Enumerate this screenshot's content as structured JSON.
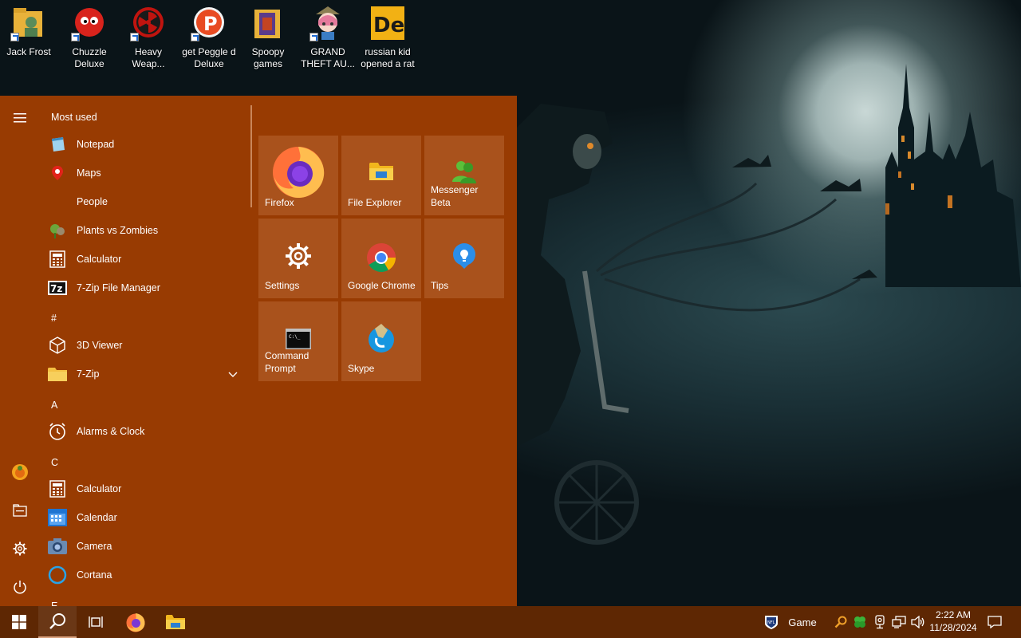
{
  "desktop": {
    "icons": [
      {
        "label": "Jack Frost",
        "icon": "folder-person-icon"
      },
      {
        "label": "Chuzzle\nDeluxe",
        "icon": "chuzzle-icon"
      },
      {
        "label": "Heavy\nWeap...",
        "icon": "radiation-icon"
      },
      {
        "label": "get Peggle d\nDeluxe",
        "icon": "peggle-icon"
      },
      {
        "label": "Spoopy\ngames",
        "icon": "folder-icon"
      },
      {
        "label": "GRAND\nTHEFT AU...",
        "icon": "anime-girl-icon"
      },
      {
        "label": "russian kid\nopened a rat",
        "icon": "de-icon"
      }
    ]
  },
  "start_menu": {
    "most_used_label": "Most used",
    "most_used": [
      {
        "label": "Notepad",
        "icon": "notepad-icon"
      },
      {
        "label": "Maps",
        "icon": "maps-icon"
      },
      {
        "label": "People",
        "icon": "people-icon"
      },
      {
        "label": "Plants vs Zombies",
        "icon": "plants-vs-zombies-icon"
      },
      {
        "label": "Calculator",
        "icon": "calculator-icon"
      },
      {
        "label": "7-Zip File Manager",
        "icon": "7zip-icon"
      }
    ],
    "sections": {
      "hash": "#",
      "a": "A",
      "c": "C",
      "e": "E"
    },
    "apps_hash": [
      {
        "label": "3D Viewer",
        "icon": "cube-icon"
      },
      {
        "label": "7-Zip",
        "icon": "folder-icon"
      }
    ],
    "apps_a": [
      {
        "label": "Alarms & Clock",
        "icon": "alarm-clock-icon"
      }
    ],
    "apps_c": [
      {
        "label": "Calculator",
        "icon": "calculator-icon"
      },
      {
        "label": "Calendar",
        "icon": "calendar-icon"
      },
      {
        "label": "Camera",
        "icon": "camera-icon"
      },
      {
        "label": "Cortana",
        "icon": "cortana-icon"
      }
    ],
    "tiles": [
      {
        "label": "Firefox",
        "icon": "firefox-icon"
      },
      {
        "label": "File Explorer",
        "icon": "file-explorer-icon"
      },
      {
        "label": "Messenger\nBeta",
        "icon": "messenger-icon"
      },
      {
        "label": "Settings",
        "icon": "gear-icon"
      },
      {
        "label": "Google Chrome",
        "icon": "chrome-icon"
      },
      {
        "label": "Tips",
        "icon": "lightbulb-icon"
      },
      {
        "label": "Command\nPrompt",
        "icon": "cmd-icon"
      },
      {
        "label": "Skype",
        "icon": "skype-icon"
      }
    ]
  },
  "taskbar": {
    "tray_label": "Game",
    "time": "2:22 AM",
    "date": "11/28/2024"
  },
  "colors": {
    "start_bg": "#983b02",
    "tile_bg": "#a9521c",
    "taskbar_bg": "#5e2703"
  }
}
